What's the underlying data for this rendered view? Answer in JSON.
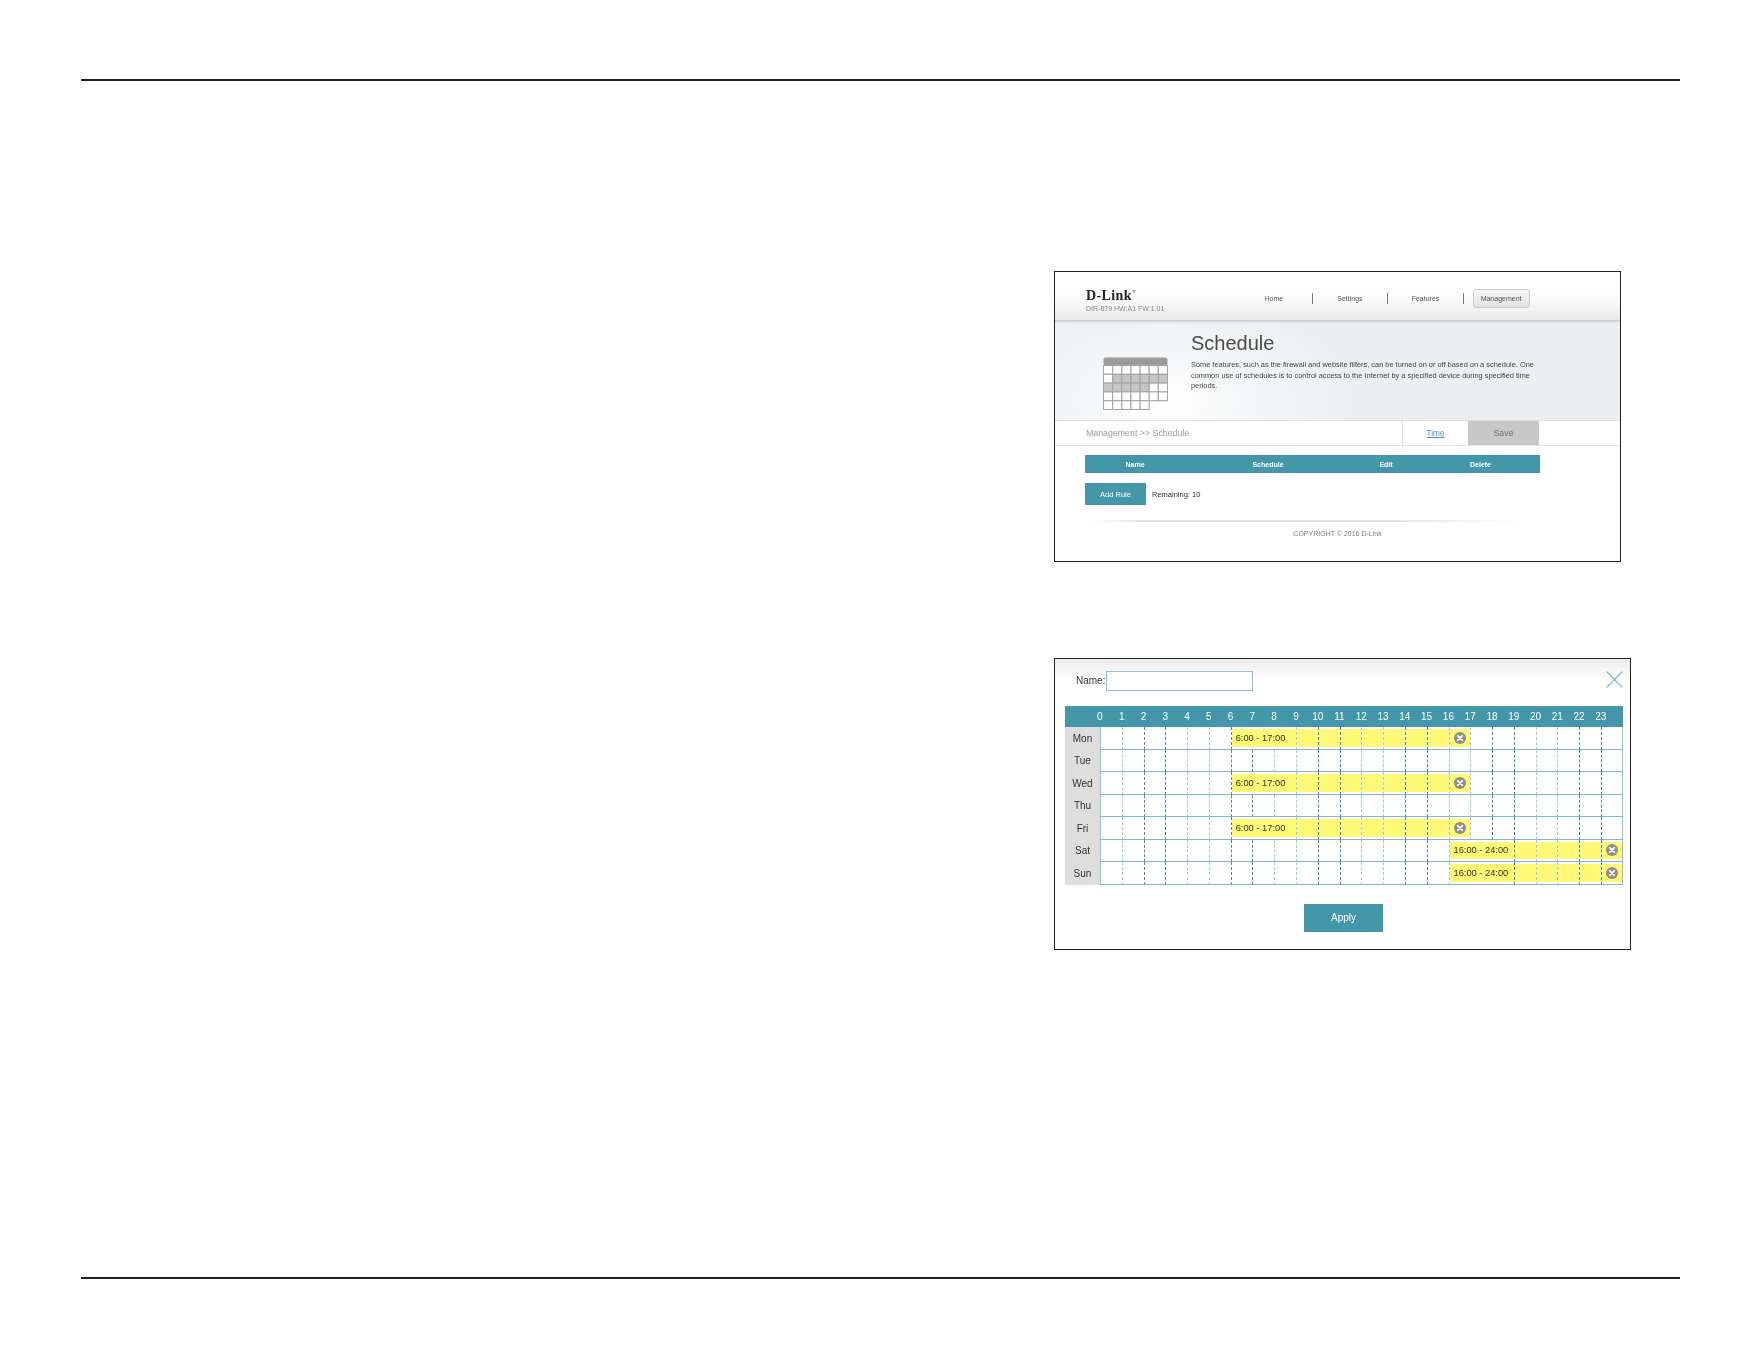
{
  "router_page": {
    "logo": "D-Link$^{®}$",
    "model": "DIR-879 HW:A1 FW:1.01",
    "nav": [
      {
        "label": "Home",
        "selected": false
      },
      {
        "label": "Settings",
        "selected": false
      },
      {
        "label": "Features",
        "selected": false
      },
      {
        "label": "Management",
        "selected": true
      }
    ],
    "title": "Schedule",
    "description": "Some features, such as the firewall and website filters, can be turned on or off based on a schedule. One common use of schedules is to control access to the Internet by a specified device during specified time periods.",
    "breadcrumb": "Management >> Schedule",
    "time_link": "Time",
    "save_button": {
      "label": "Save",
      "disabled": true
    },
    "table": {
      "columns": [
        "Name",
        "Schedule",
        "Edit",
        "Delete"
      ]
    },
    "add_rule_button": "Add Rule",
    "remaining": "Remaining: 10",
    "copyright": "COPYRIGHT © 2016 D-Link"
  },
  "schedule_dialog": {
    "name_label": "Name:",
    "hours": [
      "0",
      "1",
      "2",
      "3",
      "4",
      "5",
      "6",
      "7",
      "8",
      "9",
      "10",
      "11",
      "12",
      "13",
      "14",
      "15",
      "16",
      "17",
      "18",
      "19",
      "20",
      "21",
      "22",
      "23"
    ],
    "days": [
      {
        "label": "Mon",
        "ranges": [
          "6:00 - 17:00"
        ],
        "hours_on": [
          false,
          false,
          false,
          false,
          false,
          false,
          true,
          true,
          true,
          true,
          true,
          true,
          true,
          true,
          true,
          true,
          true,
          false,
          false,
          false,
          false,
          false,
          false,
          false
        ]
      },
      {
        "label": "Tue",
        "hours_on": [
          false,
          false,
          false,
          false,
          false,
          false,
          false,
          false,
          false,
          false,
          false,
          false,
          false,
          false,
          false,
          false,
          false,
          false,
          false,
          false,
          false,
          false,
          false,
          false
        ]
      },
      {
        "label": "Wed",
        "ranges": [
          "6:00 - 17:00"
        ],
        "hours_on": [
          false,
          false,
          false,
          false,
          false,
          false,
          true,
          true,
          true,
          true,
          true,
          true,
          true,
          true,
          true,
          true,
          true,
          false,
          false,
          false,
          false,
          false,
          false,
          false
        ]
      },
      {
        "label": "Thu",
        "hours_on": [
          false,
          false,
          false,
          false,
          false,
          false,
          false,
          false,
          false,
          false,
          false,
          false,
          false,
          false,
          false,
          false,
          false,
          false,
          false,
          false,
          false,
          false,
          false,
          false
        ]
      },
      {
        "label": "Fri",
        "ranges": [
          "6:00 - 17:00"
        ],
        "hours_on": [
          false,
          false,
          false,
          false,
          false,
          false,
          true,
          true,
          true,
          true,
          true,
          true,
          true,
          true,
          true,
          true,
          true,
          false,
          false,
          false,
          false,
          false,
          false,
          false
        ]
      },
      {
        "label": "Sat",
        "ranges": [
          "16:00 - 24:00"
        ],
        "hours_on": [
          false,
          false,
          false,
          false,
          false,
          false,
          false,
          false,
          false,
          false,
          false,
          false,
          false,
          false,
          false,
          false,
          true,
          true,
          true,
          true,
          true,
          true,
          true,
          true
        ]
      },
      {
        "label": "Sun",
        "ranges": [
          "16:00 - 24:00"
        ],
        "hours_on": [
          false,
          false,
          false,
          false,
          false,
          false,
          false,
          false,
          false,
          false,
          false,
          false,
          false,
          false,
          false,
          false,
          true,
          true,
          true,
          true,
          true,
          true,
          true,
          true
        ]
      }
    ],
    "apply_button": "Apply"
  }
}
